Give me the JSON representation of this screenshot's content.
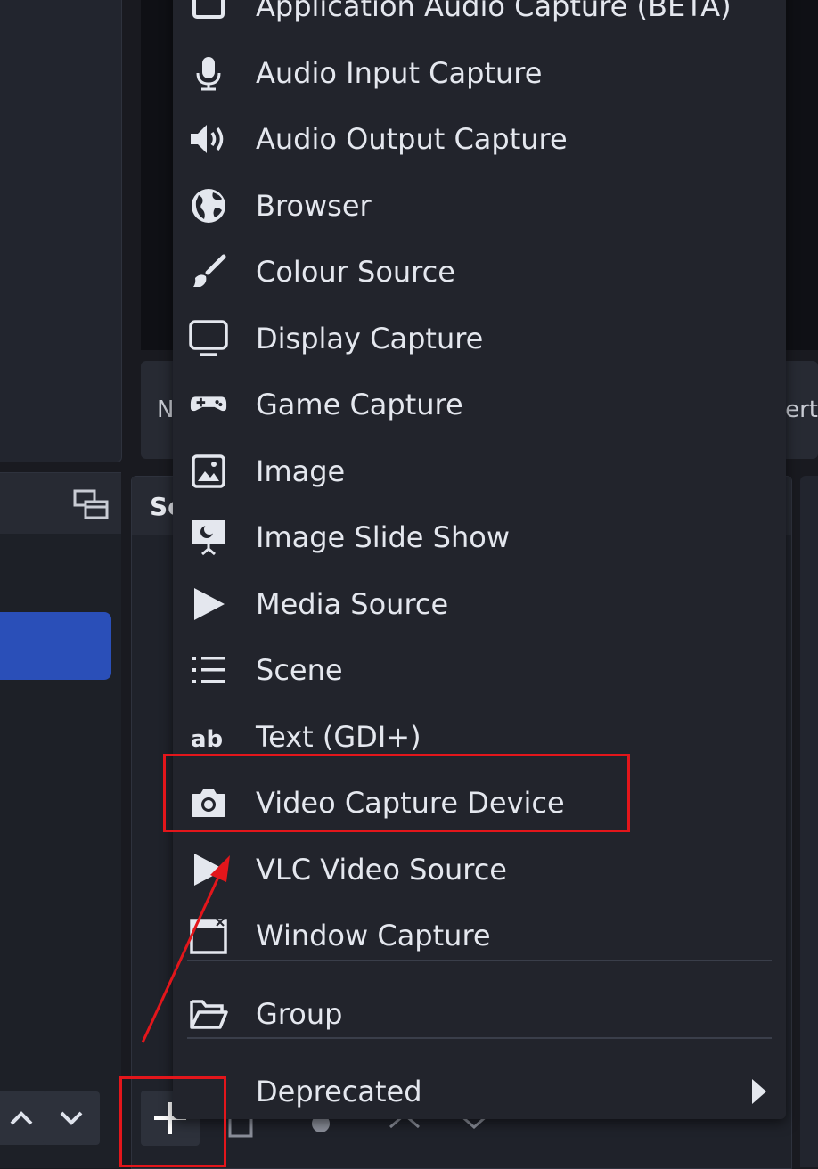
{
  "background": {
    "controls_left_fragment": "N",
    "controls_right_fragment": "ert",
    "sources_title_fragment": "Sc"
  },
  "menu": {
    "items": [
      {
        "label": "Application Audio Capture (BETA)",
        "icon": "speaker-window-icon"
      },
      {
        "label": "Audio Input Capture",
        "icon": "microphone-icon"
      },
      {
        "label": "Audio Output Capture",
        "icon": "speaker-icon"
      },
      {
        "label": "Browser",
        "icon": "globe-icon"
      },
      {
        "label": "Colour Source",
        "icon": "paintbrush-icon"
      },
      {
        "label": "Display Capture",
        "icon": "monitor-icon"
      },
      {
        "label": "Game Capture",
        "icon": "gamepad-icon"
      },
      {
        "label": "Image",
        "icon": "image-icon"
      },
      {
        "label": "Image Slide Show",
        "icon": "slideshow-icon"
      },
      {
        "label": "Media Source",
        "icon": "play-icon"
      },
      {
        "label": "Scene",
        "icon": "list-icon"
      },
      {
        "label": "Text (GDI+)",
        "icon": "text-ab-icon"
      },
      {
        "label": "Video Capture Device",
        "icon": "camera-icon"
      },
      {
        "label": "VLC Video Source",
        "icon": "play-icon"
      },
      {
        "label": "Window Capture",
        "icon": "window-icon"
      }
    ],
    "group": {
      "label": "Group",
      "icon": "folder-icon"
    },
    "deprecated": {
      "label": "Deprecated",
      "icon": "chevron-right-icon"
    }
  },
  "annotation": {
    "highlight_color": "#e3161b",
    "highlighted_item": "Video Capture Device",
    "highlighted_button": "add-source-button"
  },
  "colors": {
    "menu_bg": "#22242c",
    "selected_scene": "#2a4fb8",
    "text": "#e4e7ee"
  }
}
